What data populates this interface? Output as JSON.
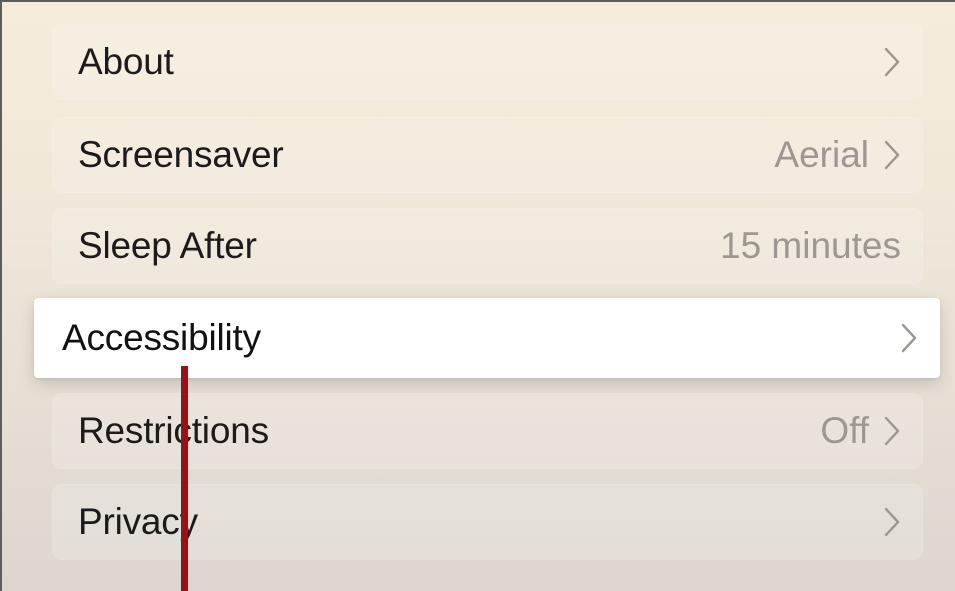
{
  "settings_list": {
    "items": [
      {
        "label": "About",
        "value": "",
        "chevron": true
      },
      {
        "label": "Screensaver",
        "value": "Aerial",
        "chevron": true
      },
      {
        "label": "Sleep After",
        "value": "15 minutes",
        "chevron": false
      },
      {
        "label": "Accessibility",
        "value": "",
        "chevron": true,
        "selected": true
      },
      {
        "label": "Restrictions",
        "value": "Off",
        "chevron": true
      },
      {
        "label": "Privacy",
        "value": "",
        "chevron": true
      }
    ]
  },
  "colors": {
    "selected_row": "#ffffff",
    "secondary_text": "#9c9891",
    "pointer_annotation": "#9a1016"
  },
  "icons": {
    "chevron": "chevron-right-icon"
  }
}
